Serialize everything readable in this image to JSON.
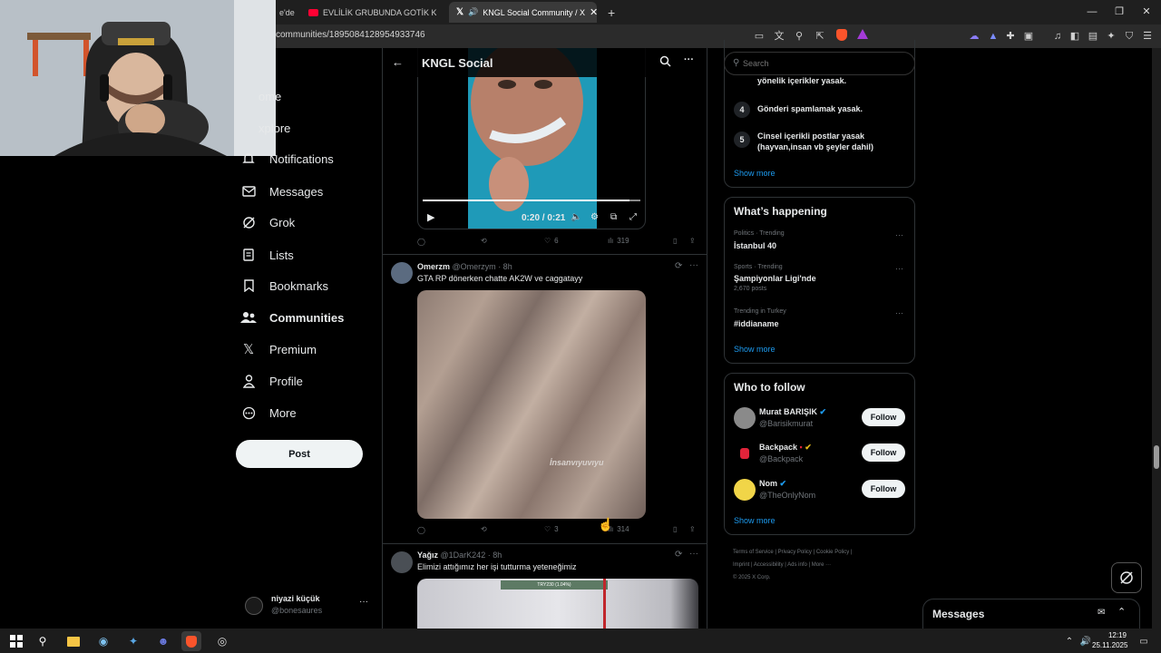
{
  "browser": {
    "tabs": [
      {
        "label": "e'de"
      },
      {
        "label": "EVLİLİK GRUBUNDA GOTİK KADIN OL"
      },
      {
        "label": "KNGL Social Community / X",
        "active": true
      }
    ],
    "url": "communities/1895084128954933746",
    "new_tab_label": "+"
  },
  "sidebar": {
    "items": [
      {
        "label": "ome",
        "icon": "home-icon"
      },
      {
        "label": "xplore",
        "icon": "explore-icon"
      },
      {
        "label": "Notifications",
        "icon": "bell-icon"
      },
      {
        "label": "Messages",
        "icon": "envelope-icon"
      },
      {
        "label": "Grok",
        "icon": "grok-icon"
      },
      {
        "label": "Lists",
        "icon": "list-icon"
      },
      {
        "label": "Bookmarks",
        "icon": "bookmark-icon"
      },
      {
        "label": "Communities",
        "icon": "communities-icon",
        "active": true
      },
      {
        "label": "Premium",
        "icon": "x-logo-icon"
      },
      {
        "label": "Profile",
        "icon": "person-icon"
      },
      {
        "label": "More",
        "icon": "more-circle-icon"
      }
    ],
    "post_label": "Post",
    "account": {
      "name": "niyazi küçük",
      "handle": "@bonesaures"
    }
  },
  "header": {
    "title": "KNGL Social"
  },
  "video1": {
    "time": "0:20 / 0:21",
    "actions": {
      "likes": "6",
      "views": "319"
    }
  },
  "posts": [
    {
      "author": "Omerzm",
      "handle": "@Omerzym",
      "time": "· 8h",
      "text": "GTA RP dönerken chatte AK2W ve caggatayy",
      "watermark": "İnsanvıyuvıyu",
      "likes": "3",
      "views": "314"
    },
    {
      "author": "Yağız",
      "handle": "@1DarK242",
      "time": "· 8h",
      "text": "Elimizi attığımız her işi tutturma yeteneğimiz",
      "overlay": "TRY230 (1.04%)"
    }
  ],
  "search": {
    "placeholder": "Search"
  },
  "rules": {
    "items": [
      {
        "num": "",
        "text": "yönelik içerikler yasak."
      },
      {
        "num": "4",
        "text": "Gönderi spamlamak yasak."
      },
      {
        "num": "5",
        "text": "Cinsel içerikli postlar yasak (hayvan,insan vb şeyler dahil)"
      }
    ],
    "show_more": "Show more"
  },
  "trends": {
    "title": "What’s happening",
    "items": [
      {
        "context": "Politics · Trending",
        "name": "İstanbul 40",
        "count": ""
      },
      {
        "context": "Sports · Trending",
        "name": "Şampiyonlar Ligi'nde",
        "count": "2,670 posts"
      },
      {
        "context": "Trending in Turkey",
        "name": "#iddianame",
        "count": ""
      }
    ],
    "show_more": "Show more"
  },
  "follow": {
    "title": "Who to follow",
    "items": [
      {
        "name": "Murat BARIŞIK",
        "handle": "@Barisikmurat",
        "button": "Follow"
      },
      {
        "name": "Backpack",
        "handle": "@Backpack",
        "button": "Follow"
      },
      {
        "name": "Nom",
        "handle": "@TheOnlyNom",
        "button": "Follow"
      }
    ],
    "show_more": "Show more"
  },
  "footer": {
    "links": [
      "Terms of Service",
      "Privacy Policy",
      "Cookie Policy",
      "Imprint",
      "Accessibility",
      "Ads info",
      "More ···"
    ],
    "copyright": "© 2025 X Corp."
  },
  "messages_drawer": {
    "title": "Messages"
  },
  "taskbar": {
    "time": "12:19",
    "date": "25.11.2025"
  },
  "colors": {
    "accent": "#1d9bf0",
    "background": "#000000",
    "border": "#2f3336"
  }
}
